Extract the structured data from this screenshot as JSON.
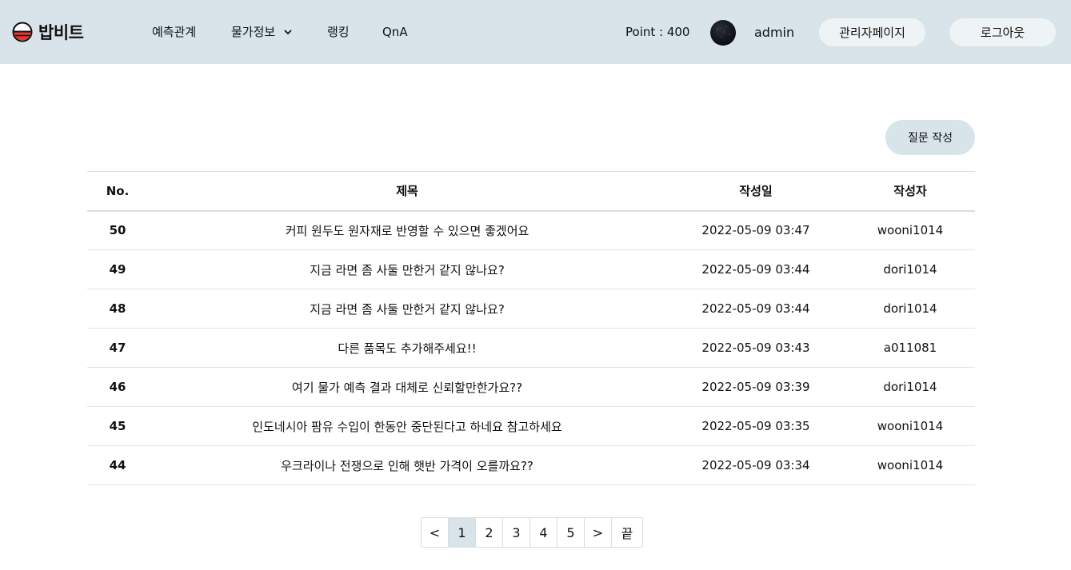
{
  "header": {
    "brand": "밥비트",
    "nav": [
      {
        "label": "예측관계"
      },
      {
        "label": "물가정보",
        "has_dropdown": true
      },
      {
        "label": "랭킹"
      },
      {
        "label": "QnA"
      }
    ],
    "point_label": "Point : 400",
    "username": "admin",
    "admin_button": "관리자페이지",
    "logout_button": "로그아웃"
  },
  "board": {
    "write_button": "질문 작성",
    "columns": {
      "no": "No.",
      "title": "제목",
      "date": "작성일",
      "author": "작성자"
    },
    "rows": [
      {
        "no": "50",
        "title": "커피 원두도 원자재로 반영할 수 있으면 좋겠어요",
        "date": "2022-05-09 03:47",
        "author": "wooni1014"
      },
      {
        "no": "49",
        "title": "지금 라면 좀 사둘 만한거 같지 않나요?",
        "date": "2022-05-09 03:44",
        "author": "dori1014"
      },
      {
        "no": "48",
        "title": "지금 라면 좀 사둘 만한거 같지 않나요?",
        "date": "2022-05-09 03:44",
        "author": "dori1014"
      },
      {
        "no": "47",
        "title": "다른 품목도 추가해주세요!!",
        "date": "2022-05-09 03:43",
        "author": "a011081"
      },
      {
        "no": "46",
        "title": "여기 물가 예측 결과 대체로 신뢰할만한가요??",
        "date": "2022-05-09 03:39",
        "author": "dori1014"
      },
      {
        "no": "45",
        "title": "인도네시아 팜유 수입이 한동안 중단된다고 하네요 참고하세요",
        "date": "2022-05-09 03:35",
        "author": "wooni1014"
      },
      {
        "no": "44",
        "title": "우크라이나 전쟁으로 인해 햇반 가격이 오를까요??",
        "date": "2022-05-09 03:34",
        "author": "wooni1014"
      }
    ]
  },
  "pagination": {
    "prev": "<",
    "pages": [
      "1",
      "2",
      "3",
      "4",
      "5"
    ],
    "current": "1",
    "next": ">",
    "last": "끝"
  },
  "colors": {
    "header_bg": "#d8e4e9",
    "button_bg": "#eef3f5",
    "logo_red": "#e8352b"
  },
  "icons": {
    "logo": "rice-bowl-icon",
    "dropdown": "chevron-down-icon",
    "avatar": "user-avatar"
  }
}
